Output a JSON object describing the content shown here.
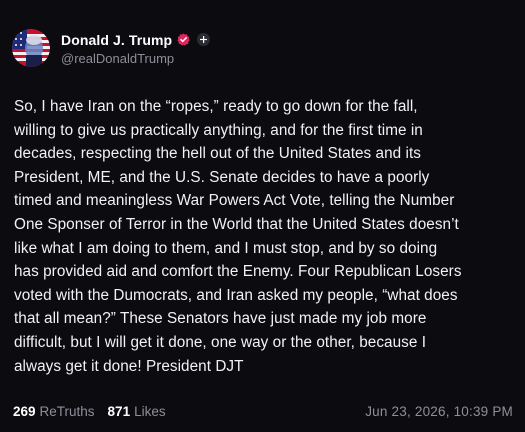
{
  "author": {
    "display_name": "Donald J. Trump",
    "handle": "@realDonaldTrump"
  },
  "icons": {
    "verified": "verified-badge-icon",
    "follow": "plus-icon"
  },
  "colors": {
    "verified_badge": "#e0245e",
    "background": "#0c0c10"
  },
  "post": {
    "text": "So, I have Iran on the “ropes,” ready to go down for the fall,\nwilling to give us practically anything, and for the first time in\ndecades, respecting the hell out of the United States and its\nPresident, ME, and the U.S. Senate decides to have a poorly\ntimed and meaningless War Powers Act Vote, telling the Number\nOne Sponser of Terror in the World that the United States doesn’t\nlike what I am doing to them, and I must stop, and by so doing\nhas provided aid and comfort the Enemy. Four Republican Losers\nvoted with the Dumocrats, and Iran asked my people, “what does\nthat all mean?” These Senators have just made my job more\ndifficult, but I will get it done, one way or the other, because I\nalways get it done! President DJT"
  },
  "stats": {
    "retruths_count": "269",
    "retruths_label": "ReTruths",
    "likes_count": "871",
    "likes_label": "Likes"
  },
  "timestamp": "Jun 23, 2026, 10:39 PM"
}
